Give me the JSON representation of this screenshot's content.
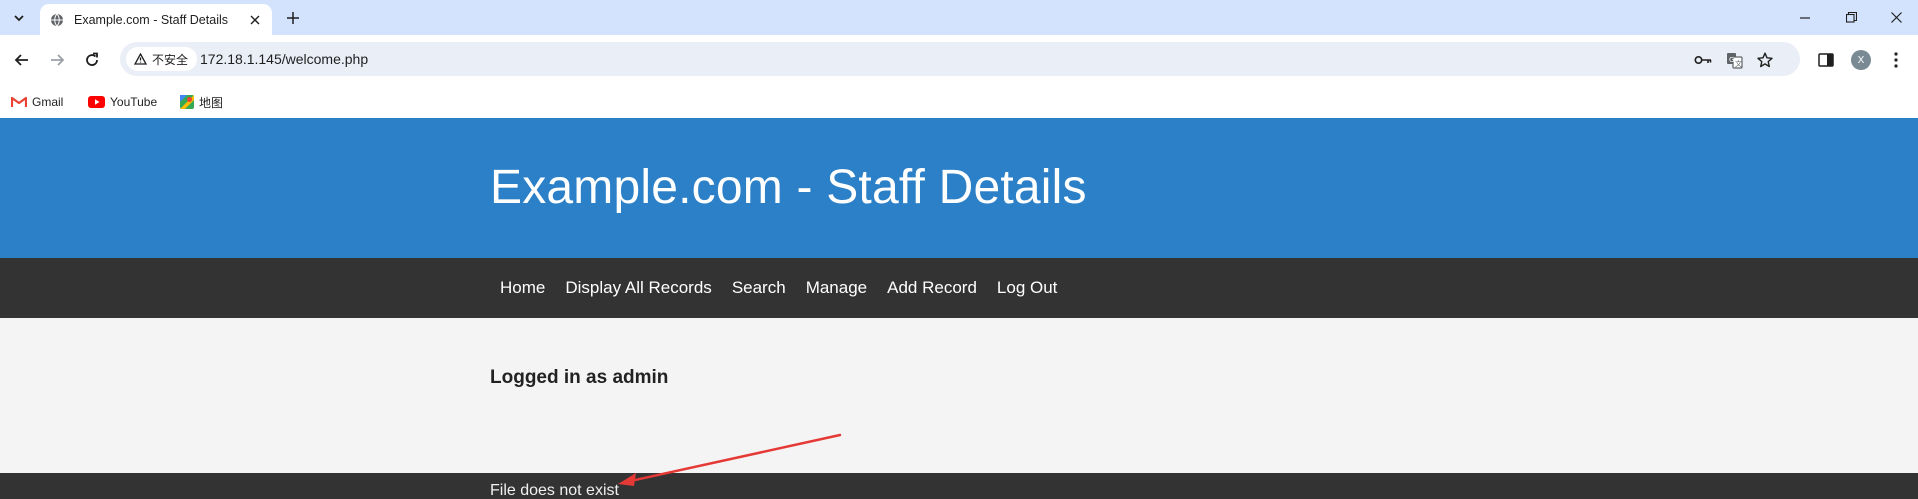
{
  "browser": {
    "tab": {
      "title": "Example.com - Staff Details"
    },
    "address_bar": {
      "security_label": "不安全",
      "url": "172.18.1.145/welcome.php"
    },
    "bookmarks": [
      {
        "label": "Gmail",
        "icon": "gmail-icon"
      },
      {
        "label": "YouTube",
        "icon": "youtube-icon"
      },
      {
        "label": "地图",
        "icon": "maps-icon"
      }
    ],
    "profile_initial": "X"
  },
  "page": {
    "header": {
      "title": "Example.com - Staff Details"
    },
    "nav": [
      {
        "label": "Home"
      },
      {
        "label": "Display All Records"
      },
      {
        "label": "Search"
      },
      {
        "label": "Manage"
      },
      {
        "label": "Add Record"
      },
      {
        "label": "Log Out"
      }
    ],
    "status": {
      "logged_in_text": "Logged in as admin"
    },
    "footer": {
      "message": "File does not exist"
    }
  },
  "colors": {
    "header_bg": "#2c80c7",
    "nav_bg": "#333333",
    "content_bg": "#f4f4f4",
    "annotation_arrow": "#e53935"
  }
}
